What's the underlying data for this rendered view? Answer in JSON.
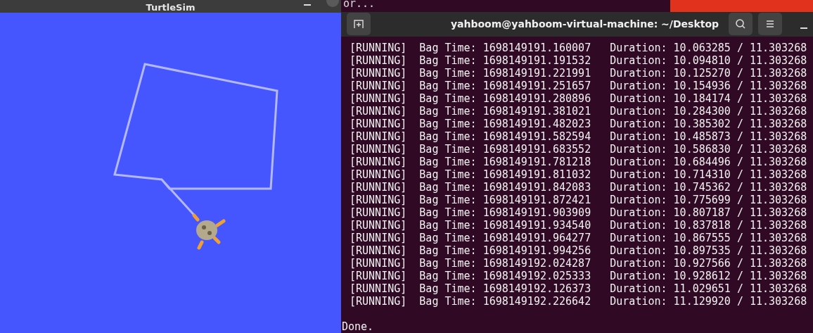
{
  "background_window": {
    "text": "or..."
  },
  "turtlesim": {
    "title": "TurtleSim"
  },
  "terminal": {
    "title": "yahboom@yahboom-virtual-machine: ~/Desktop",
    "lines": [
      "[RUNNING]  Bag Time: 1698149191.160007   Duration: 10.063285 / 11.303268",
      "[RUNNING]  Bag Time: 1698149191.191532   Duration: 10.094810 / 11.303268",
      "[RUNNING]  Bag Time: 1698149191.221991   Duration: 10.125270 / 11.303268",
      "[RUNNING]  Bag Time: 1698149191.251657   Duration: 10.154936 / 11.303268",
      "[RUNNING]  Bag Time: 1698149191.280896   Duration: 10.184174 / 11.303268",
      "[RUNNING]  Bag Time: 1698149191.381021   Duration: 10.284300 / 11.303268",
      "[RUNNING]  Bag Time: 1698149191.482023   Duration: 10.385302 / 11.303268",
      "[RUNNING]  Bag Time: 1698149191.582594   Duration: 10.485873 / 11.303268",
      "[RUNNING]  Bag Time: 1698149191.683552   Duration: 10.586830 / 11.303268",
      "[RUNNING]  Bag Time: 1698149191.781218   Duration: 10.684496 / 11.303268",
      "[RUNNING]  Bag Time: 1698149191.811032   Duration: 10.714310 / 11.303268",
      "[RUNNING]  Bag Time: 1698149191.842083   Duration: 10.745362 / 11.303268",
      "[RUNNING]  Bag Time: 1698149191.872421   Duration: 10.775699 / 11.303268",
      "[RUNNING]  Bag Time: 1698149191.903909   Duration: 10.807187 / 11.303268",
      "[RUNNING]  Bag Time: 1698149191.934540   Duration: 10.837818 / 11.303268",
      "[RUNNING]  Bag Time: 1698149191.964277   Duration: 10.867555 / 11.303268",
      "[RUNNING]  Bag Time: 1698149191.994256   Duration: 10.897535 / 11.303268",
      "[RUNNING]  Bag Time: 1698149192.024287   Duration: 10.927566 / 11.303268",
      "[RUNNING]  Bag Time: 1698149192.025333   Duration: 10.928612 / 11.303268",
      "[RUNNING]  Bag Time: 1698149192.126373   Duration: 11.029651 / 11.303268",
      "[RUNNING]  Bag Time: 1698149192.226642   Duration: 11.129920 / 11.303268"
    ],
    "footer": "Done."
  }
}
